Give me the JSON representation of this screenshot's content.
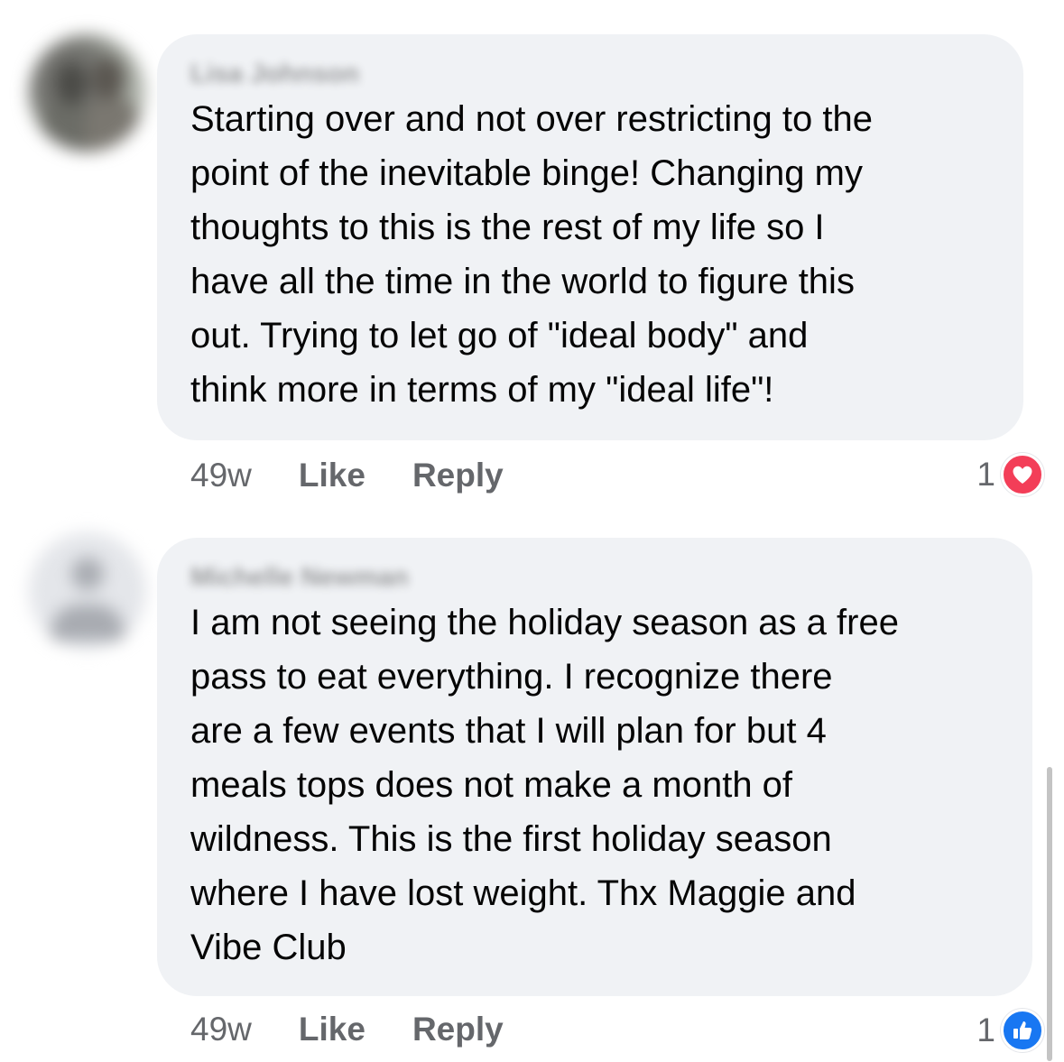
{
  "comments": [
    {
      "author": "Lisa Johnson",
      "text": "Starting over and not over restricting to the\npoint of the inevitable binge! Changing my\nthoughts to this is the rest of my life so I\nhave all the time in the world to figure this\nout. Trying to let go of \"ideal body\" and\nthink more in terms of my \"ideal life\"!",
      "time": "49w",
      "like_label": "Like",
      "reply_label": "Reply",
      "reaction_count": "1",
      "reaction_type": "love-icon",
      "reaction_color": "#f33e58"
    },
    {
      "author": "Michelle Newman",
      "text": "I am not seeing the holiday season as a free\npass to eat everything.  I recognize there\nare a few events that I will plan for but 4\nmeals tops does not make a month of\nwildness.  This is the first holiday season\nwhere I have lost weight.  Thx Maggie and\nVibe Club",
      "time": "49w",
      "like_label": "Like",
      "reply_label": "Reply",
      "reaction_count": "1",
      "reaction_type": "like-icon",
      "reaction_color": "#1877f2"
    }
  ],
  "colors": {
    "bubble_bg": "#f0f2f5",
    "meta_text": "#65676b",
    "body_text": "#050505"
  }
}
